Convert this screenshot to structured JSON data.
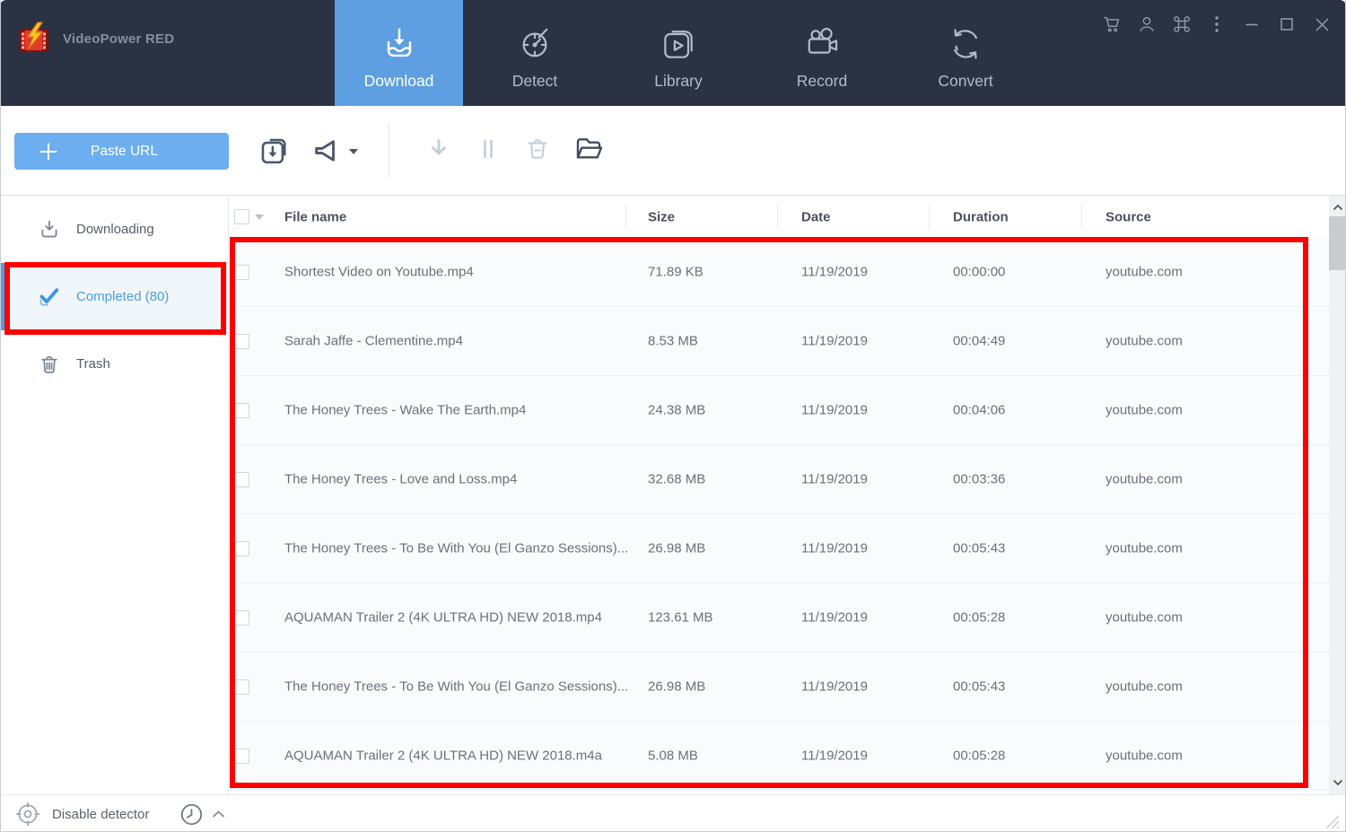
{
  "app": {
    "title": "VideoPower RED"
  },
  "nav": {
    "tabs": [
      {
        "label": "Download",
        "icon": "download-tray-icon",
        "active": true
      },
      {
        "label": "Detect",
        "icon": "detect-timer-icon",
        "active": false
      },
      {
        "label": "Library",
        "icon": "library-icon",
        "active": false
      },
      {
        "label": "Record",
        "icon": "record-camera-icon",
        "active": false
      },
      {
        "label": "Convert",
        "icon": "convert-icon",
        "active": false
      }
    ],
    "titlebar_icons": [
      "cart-icon",
      "user-icon",
      "command-icon",
      "more-icon",
      "minimize-icon",
      "maximize-icon",
      "close-icon"
    ]
  },
  "toolbar": {
    "paste_url_label": "Paste URL",
    "icons": [
      "batch-download-icon",
      "speaker-icon",
      "resume-download-icon",
      "pause-icon",
      "delete-icon",
      "open-folder-icon"
    ]
  },
  "sidebar": {
    "items": [
      {
        "label": "Downloading",
        "icon": "download-icon",
        "active": false
      },
      {
        "label": "Completed (80)",
        "icon": "check-icon",
        "active": true
      },
      {
        "label": "Trash",
        "icon": "trash-icon",
        "active": false
      }
    ]
  },
  "table": {
    "columns": [
      {
        "label": "File name"
      },
      {
        "label": "Size"
      },
      {
        "label": "Date"
      },
      {
        "label": "Duration"
      },
      {
        "label": "Source"
      }
    ],
    "rows": [
      {
        "name": "Shortest Video on Youtube.mp4",
        "size": "71.89 KB",
        "date": "11/19/2019",
        "duration": "00:00:00",
        "source": "youtube.com"
      },
      {
        "name": "Sarah Jaffe - Clementine.mp4",
        "size": "8.53 MB",
        "date": "11/19/2019",
        "duration": "00:04:49",
        "source": "youtube.com"
      },
      {
        "name": "The Honey Trees - Wake The Earth.mp4",
        "size": "24.38 MB",
        "date": "11/19/2019",
        "duration": "00:04:06",
        "source": "youtube.com"
      },
      {
        "name": "The Honey Trees - Love and Loss.mp4",
        "size": "32.68 MB",
        "date": "11/19/2019",
        "duration": "00:03:36",
        "source": "youtube.com"
      },
      {
        "name": "The Honey Trees - To Be With You (El Ganzo Sessions)...",
        "size": "26.98 MB",
        "date": "11/19/2019",
        "duration": "00:05:43",
        "source": "youtube.com"
      },
      {
        "name": "AQUAMAN Trailer 2 (4K ULTRA HD) NEW 2018.mp4",
        "size": "123.61 MB",
        "date": "11/19/2019",
        "duration": "00:05:28",
        "source": "youtube.com"
      },
      {
        "name": "The Honey Trees - To Be With You (El Ganzo Sessions)...",
        "size": "26.98 MB",
        "date": "11/19/2019",
        "duration": "00:05:43",
        "source": "youtube.com"
      },
      {
        "name": "AQUAMAN Trailer 2 (4K ULTRA HD) NEW 2018.m4a",
        "size": "5.08 MB",
        "date": "11/19/2019",
        "duration": "00:05:28",
        "source": "youtube.com"
      }
    ]
  },
  "statusbar": {
    "detector_label": "Disable detector"
  },
  "annotations": {
    "highlight_color": "#fe0000",
    "highlighted_items": [
      "completed-sidebar-item",
      "completed-file-list"
    ]
  },
  "colors": {
    "topbar_bg": "#2b3244",
    "active_tab_blue": "#5d9fe0",
    "paste_button_blue": "#6caeef",
    "link_blue": "#4b9fe4",
    "annotation_red": "#fe0000"
  }
}
